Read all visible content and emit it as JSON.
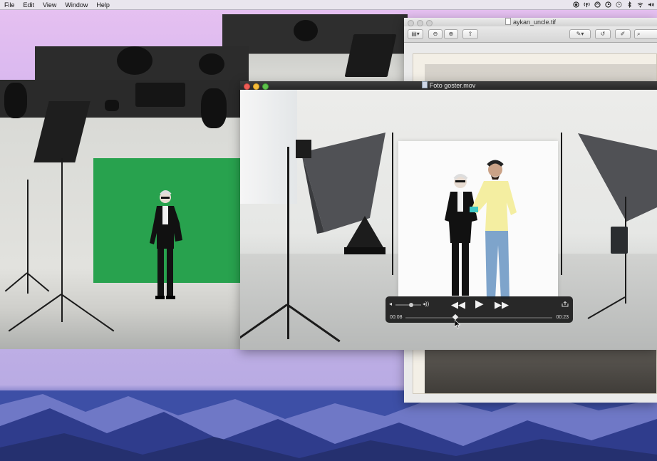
{
  "menubar": {
    "items": [
      "File",
      "Edit",
      "View",
      "Window",
      "Help"
    ],
    "status_icons": [
      "record-icon",
      "broadcast-icon",
      "sync-icon",
      "clock-icon",
      "time-machine-icon",
      "bluetooth-icon",
      "wifi-icon",
      "volume-icon"
    ]
  },
  "preview_window": {
    "title": "aykan_uncle.tif"
  },
  "movie_window": {
    "title": "Foto goster.mov",
    "player": {
      "elapsed": "00:08",
      "remaining": "00:23",
      "progress": 0.34,
      "volume": 0.6
    }
  },
  "colors": {
    "green_screen": "#28a24e",
    "menubar": "#e9e6ee",
    "hud": "#121212"
  }
}
